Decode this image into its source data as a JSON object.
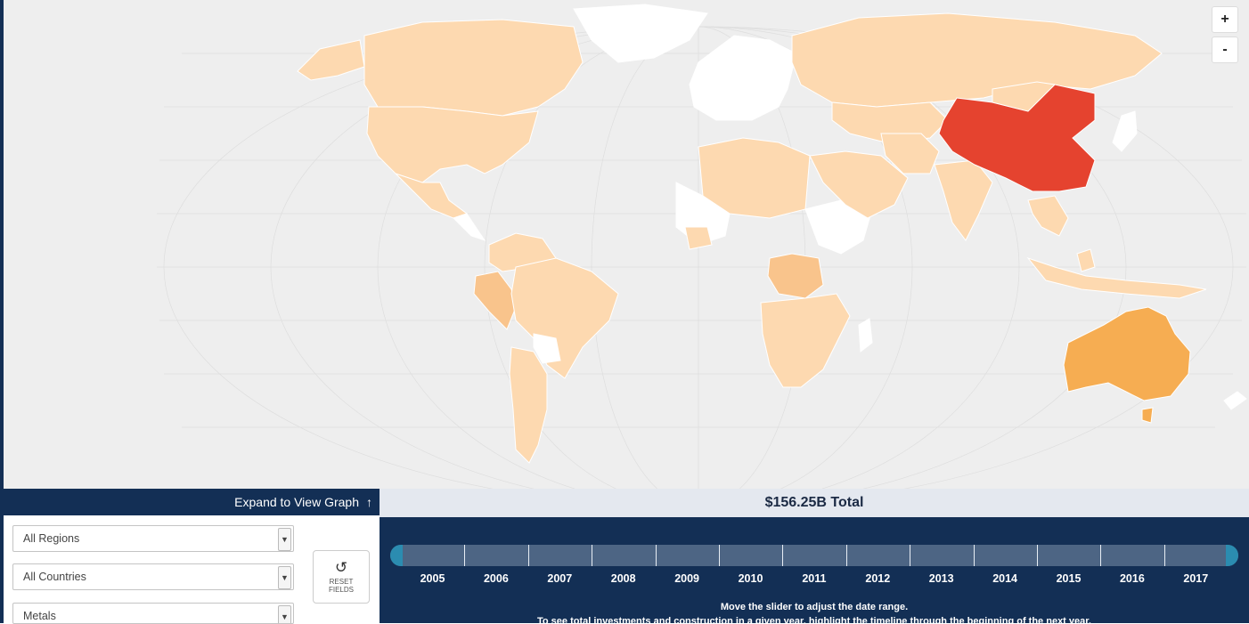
{
  "map": {
    "zoom_in_label": "+",
    "zoom_out_label": "-",
    "colors": {
      "ocean": "#eeeeee",
      "land_default": "#ffffff",
      "low": "#fdd9b0",
      "mid": "#f9c48c",
      "high": "#f6ad52",
      "top": "#e5432f"
    },
    "highlighted_countries": [
      {
        "name": "China",
        "level": "top",
        "color": "#e5432f"
      },
      {
        "name": "Australia",
        "level": "high",
        "color": "#f6ad52"
      },
      {
        "name": "Peru",
        "level": "mid",
        "color": "#f9c48c"
      },
      {
        "name": "DR Congo",
        "level": "mid",
        "color": "#f9c48c"
      }
    ]
  },
  "controls": {
    "expand_label": "Expand to View Graph",
    "expand_arrow": "↑",
    "regions_value": "All Regions",
    "countries_value": "All Countries",
    "sector_value": "Metals",
    "reset_icon": "↺",
    "reset_label_line1": "RESET",
    "reset_label_line2": "FIELDS"
  },
  "summary": {
    "total": "$156.25B Total"
  },
  "timeline": {
    "years": [
      "2005",
      "2006",
      "2007",
      "2008",
      "2009",
      "2010",
      "2011",
      "2012",
      "2013",
      "2014",
      "2015",
      "2016",
      "2017"
    ],
    "range_start": "2005",
    "range_end": "2017",
    "instruction1": "Move the slider to adjust the date range.",
    "instruction2": "To see total investments and construction in a given year, highlight the timeline through the beginning of the next year."
  }
}
